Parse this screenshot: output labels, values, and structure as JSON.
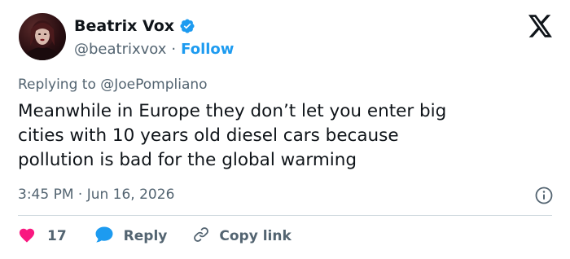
{
  "author": {
    "name": "Beatrix Vox",
    "handle": "@beatrixvox",
    "separator": "·",
    "follow_label": "Follow",
    "verified": true
  },
  "reply_context": {
    "prefix": "Replying to ",
    "mention": "@JoePompliano"
  },
  "tweet": {
    "text": "Meanwhile in Europe they don’t let you enter big\ncities with 10 years old diesel cars because\npollution is bad for the global warming",
    "timestamp": "3:45 PM · Jun 16, 2026"
  },
  "actions": {
    "like_count": "17",
    "reply_label": "Reply",
    "copy_label": "Copy link"
  },
  "icons": {
    "logo": "x-logo-icon",
    "verified": "verified-badge-icon",
    "info": "info-icon",
    "like": "heart-icon",
    "reply": "speech-bubble-icon",
    "copy": "link-icon"
  },
  "colors": {
    "accent": "#1d9bf0",
    "like": "#f91880",
    "text": "#0f1419",
    "secondary": "#536471"
  }
}
